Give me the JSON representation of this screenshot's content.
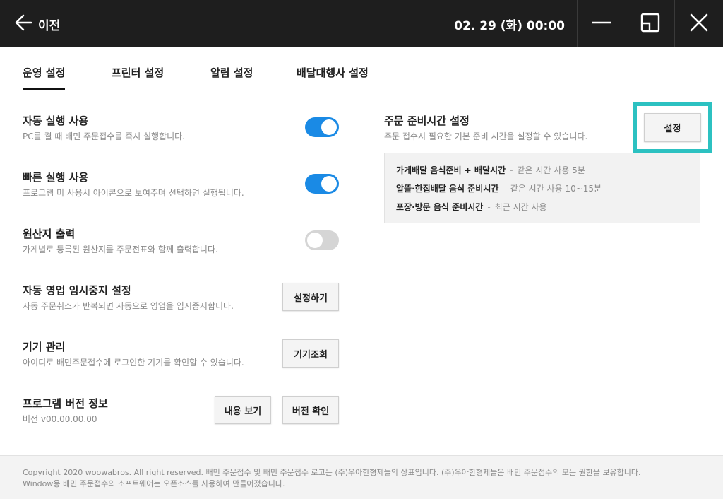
{
  "header": {
    "back_label": "이전",
    "datetime": "02. 29 (화) 00:00",
    "icons": [
      "back-arrow-icon",
      "minimize-icon",
      "restore-window-icon",
      "close-icon"
    ]
  },
  "tabs": [
    {
      "label": "운영 설정",
      "active": true
    },
    {
      "label": "프린터 설정",
      "active": false
    },
    {
      "label": "알림 설정",
      "active": false
    },
    {
      "label": "배달대행사 설정",
      "active": false
    }
  ],
  "settings": {
    "auto_run": {
      "title": "자동 실행 사용",
      "desc": "PC를 켤 때 배민 주문접수를 즉시 실행합니다.",
      "enabled": true
    },
    "quick_run": {
      "title": "빠른 실행 사용",
      "desc": "프로그램 미 사용시 아이콘으로 보여주며 선택하면 실행됩니다.",
      "enabled": true
    },
    "origin_print": {
      "title": "원산지 출력",
      "desc": "가게별로 등록된 원산지를 주문전표와 함께 출력합니다.",
      "enabled": false
    },
    "auto_pause": {
      "title": "자동 영업 임시중지 설정",
      "desc": "자동 주문취소가 반복되면 자동으로 영업을 임시중지합니다.",
      "button": "설정하기"
    },
    "device": {
      "title": "기기 관리",
      "desc": "아이디로 배민주문접수에 로그인한 기기를 확인할 수 있습니다.",
      "button": "기기조회"
    },
    "version": {
      "title": "프로그램 버전 정보",
      "desc": "버전 v00.00.00.00",
      "button_view": "내용 보기",
      "button_check": "버전 확인"
    }
  },
  "prep_time": {
    "title": "주문 준비시간 설정",
    "desc": "주문 접수시 필요한 기본 준비 시간을 설정할 수 있습니다.",
    "button": "설정",
    "highlight_color": "#2cc1c1",
    "lines": [
      {
        "label": "가게배달 음식준비 + 배달시간",
        "sep": "-",
        "value": "같은 시간 사용 5분"
      },
      {
        "label": "알뜰·한집배달 음식 준비시간",
        "sep": "-",
        "value": "같은 시간 사용 10~15분"
      },
      {
        "label": "포장·방문 음식 준비시간",
        "sep": "-",
        "value": "최근 시간 사용"
      }
    ]
  },
  "footer": {
    "line1": "Copyright 2020 woowabros. All right reserved. 배민 주문접수 및 배민 주문접수 로고는 (주)우아한형제들의 상표입니다. (주)우아한형제들은 배민 주문접수의 모든 권한을 보유합니다.",
    "line2": "Window용 배민 주문접수의 소프트웨어는 오픈소스를 사용하여 만들어졌습니다."
  },
  "colors": {
    "titlebar": "#1e1e1e",
    "toggle_on": "#1a8ae5",
    "toggle_off": "#d5d5d5"
  }
}
